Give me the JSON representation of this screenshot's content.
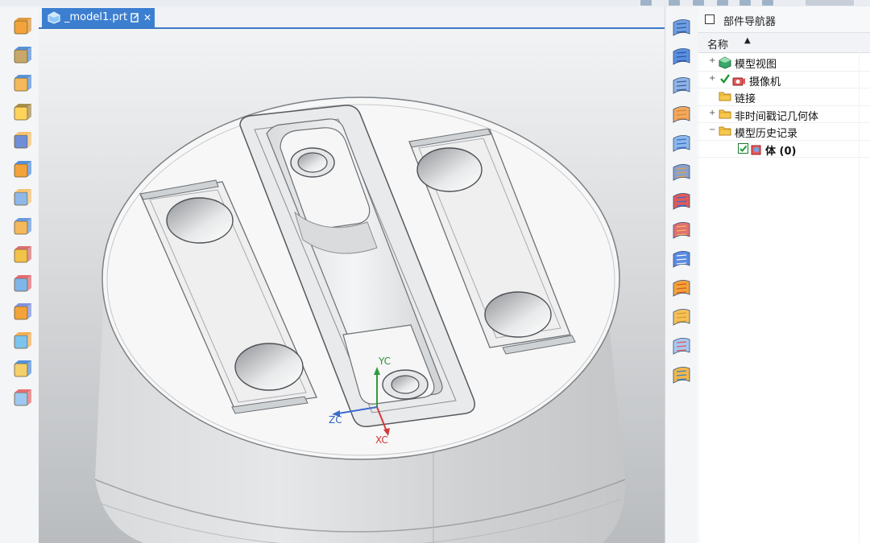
{
  "document_tab": {
    "title": "_model1.prt",
    "close_glyph": "✕"
  },
  "navigator": {
    "title": "部件导航器",
    "column_name": "名称",
    "sort_glyph": "▲",
    "items": [
      {
        "label": "模型视图",
        "expander": "+",
        "icon": "model-views-icon"
      },
      {
        "label": "摄像机",
        "expander": "+",
        "icon": "camera-icon",
        "checked": true
      },
      {
        "label": "链接",
        "expander": "",
        "icon": "folder-icon"
      },
      {
        "label": "非时间戳记几何体",
        "expander": "+",
        "icon": "folder-icon"
      },
      {
        "label": "模型历史记录",
        "expander": "−",
        "icon": "folder-icon"
      },
      {
        "label": "体 (0)",
        "expander": "",
        "icon": "body-icon",
        "checked": true
      }
    ]
  },
  "triad": {
    "xc": "XC",
    "yc": "YC",
    "zc": "ZC"
  },
  "colors": {
    "accent": "#3c7fd1",
    "model_gray": "#d9dbdd",
    "face_white": "#f7f7f7",
    "axis_red": "#d53a3a",
    "axis_green": "#2e9b40",
    "axis_blue": "#3a6ccf"
  },
  "left_toolbar_icons": [
    "extrude-icon",
    "revolve-icon",
    "hole-icon",
    "boss-icon",
    "pad-icon",
    "block-icon",
    "cylinder-icon",
    "cone-icon",
    "sweep-icon",
    "edge-blend-icon",
    "chamfer-icon",
    "shell-icon",
    "draft-icon",
    "trim-icon"
  ],
  "right_toolbar_icons": [
    "surface-icon",
    "grid-surface-icon",
    "offset-face-icon",
    "pattern-icon",
    "tube-icon",
    "thread-icon",
    "mirror-icon",
    "emboss-icon",
    "split-icon",
    "fillet-icon",
    "flange-icon",
    "scale-icon",
    "unite-icon"
  ]
}
